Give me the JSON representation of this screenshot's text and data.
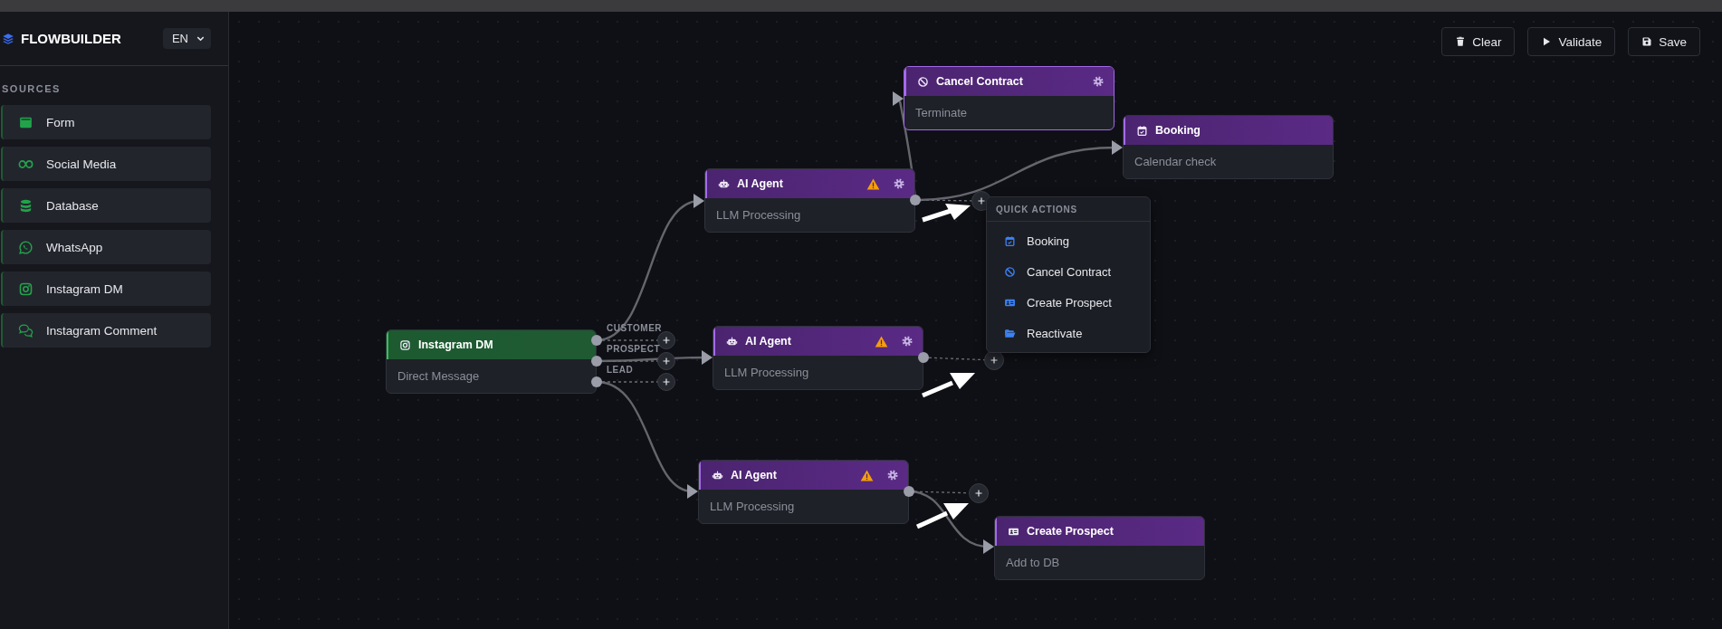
{
  "sidebar": {
    "brand": "FLOWBUILDER",
    "language": "EN",
    "section_title": "SOURCES",
    "items": [
      {
        "label": "Form",
        "kind": "form"
      },
      {
        "label": "Social Media",
        "kind": "infinity"
      },
      {
        "label": "Database",
        "kind": "database"
      },
      {
        "label": "WhatsApp",
        "kind": "whatsapp"
      },
      {
        "label": "Instagram DM",
        "kind": "instagram"
      },
      {
        "label": "Instagram Comment",
        "kind": "comments"
      }
    ]
  },
  "toolbar": [
    {
      "label": "Clear",
      "kind": "trash"
    },
    {
      "label": "Validate",
      "kind": "play"
    },
    {
      "label": "Save",
      "kind": "save"
    }
  ],
  "nodes": [
    {
      "kind": "cancel",
      "title": "Cancel Contract",
      "subtitle": "Terminate",
      "warning": false,
      "settings": true,
      "selected": true
    },
    {
      "kind": "booking",
      "title": "Booking",
      "subtitle": "Calendar check",
      "warning": false,
      "settings": false,
      "selected": false
    },
    {
      "kind": "robot",
      "title": "AI Agent",
      "subtitle": "LLM Processing",
      "warning": true,
      "settings": true,
      "selected": false
    },
    {
      "kind": "instagram",
      "title": "Instagram DM",
      "subtitle": "Direct Message",
      "warning": false,
      "settings": false,
      "selected": false,
      "outputs": [
        {
          "label": "CUSTOMER"
        },
        {
          "label": "PROSPECT"
        },
        {
          "label": "LEAD"
        }
      ]
    },
    {
      "kind": "robot",
      "title": "AI Agent",
      "subtitle": "LLM Processing",
      "warning": true,
      "settings": true,
      "selected": false
    },
    {
      "kind": "robot",
      "title": "AI Agent",
      "subtitle": "LLM Processing",
      "warning": true,
      "settings": true,
      "selected": false
    },
    {
      "kind": "prospect",
      "title": "Create Prospect",
      "subtitle": "Add to DB",
      "warning": false,
      "settings": false,
      "selected": false
    }
  ],
  "quick_actions": {
    "title": "QUICK ACTIONS",
    "items": [
      {
        "label": "Booking",
        "kind": "booking"
      },
      {
        "label": "Cancel Contract",
        "kind": "cancel"
      },
      {
        "label": "Create Prospect",
        "kind": "prospect"
      },
      {
        "label": "Reactivate",
        "kind": "folder"
      }
    ]
  }
}
